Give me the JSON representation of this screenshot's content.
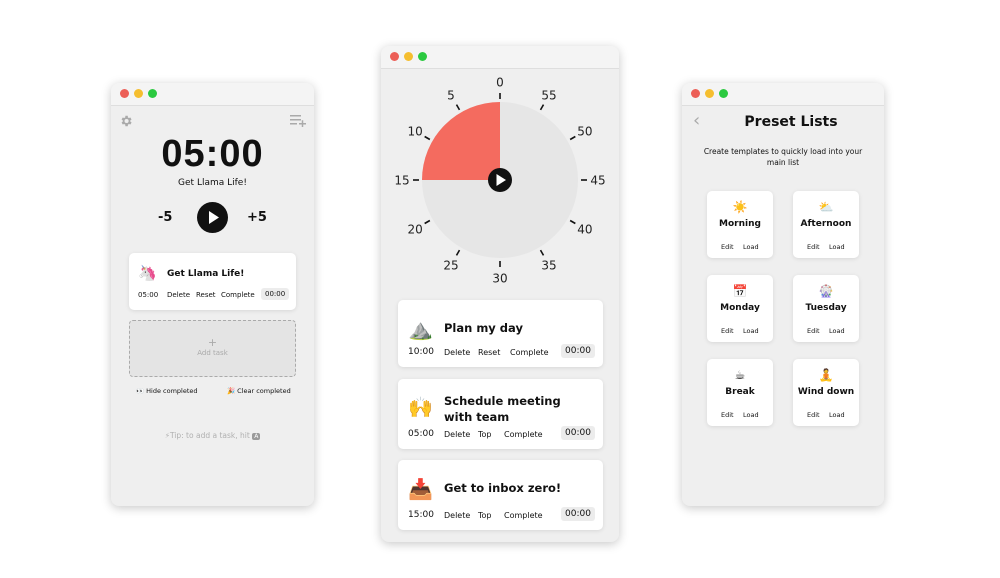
{
  "colors": {
    "red_dot": "#ec5f57",
    "yellow_dot": "#f5be2f",
    "green_dot": "#2bc940",
    "dial_sector": "#f46b5f",
    "dial_face": "#e6e6e6"
  },
  "left": {
    "settings_icon": "gear-icon",
    "list_icon": "playlist-add-icon",
    "timer": "05:00",
    "task_name": "Get Llama Life!",
    "minus": "-5",
    "plus": "+5",
    "card": {
      "emoji": "🦄",
      "title": "Get Llama Life!",
      "time": "05:00",
      "delete": "Delete",
      "reset": "Reset",
      "complete": "Complete",
      "elapsed": "00:00"
    },
    "add_plus": "+",
    "add_task": "Add task",
    "hide_completed": "👀 Hide completed",
    "clear_completed": "🎉 Clear completed",
    "tip": "⚡Tip: to add a task, hit",
    "tip_key": "A"
  },
  "center": {
    "dial": {
      "minutes": 15,
      "labels": [
        "0",
        "5",
        "10",
        "15",
        "20",
        "25",
        "30",
        "35",
        "40",
        "45",
        "50",
        "55"
      ]
    },
    "tasks": [
      {
        "emoji": "⛰️",
        "title_lines": [
          "Plan my day"
        ],
        "time": "10:00",
        "actions": [
          "Delete",
          "Reset",
          "Complete"
        ],
        "elapsed": "00:00"
      },
      {
        "emoji": "🙌",
        "title_lines": [
          "Schedule meeting",
          "with team"
        ],
        "time": "05:00",
        "actions": [
          "Delete",
          "Top",
          "Complete"
        ],
        "elapsed": "00:00"
      },
      {
        "emoji": "📥",
        "title_lines": [
          "Get to inbox zero!"
        ],
        "time": "15:00",
        "actions": [
          "Delete",
          "Top",
          "Complete"
        ],
        "elapsed": "00:00"
      }
    ]
  },
  "right": {
    "back": "‹",
    "title": "Preset Lists",
    "subtitle_lines": [
      "Create templates to quickly load into your",
      "main list"
    ],
    "presets": [
      {
        "emoji": "☀️",
        "name": "Morning",
        "edit": "Edit",
        "load": "Load"
      },
      {
        "emoji": "⛅",
        "name": "Afternoon",
        "edit": "Edit",
        "load": "Load"
      },
      {
        "emoji": "📅",
        "name": "Monday",
        "edit": "Edit",
        "load": "Load"
      },
      {
        "emoji": "🎡",
        "name": "Tuesday",
        "edit": "Edit",
        "load": "Load"
      },
      {
        "emoji": "☕",
        "name": "Break",
        "edit": "Edit",
        "load": "Load"
      },
      {
        "emoji": "🧘",
        "name": "Wind down",
        "edit": "Edit",
        "load": "Load"
      }
    ]
  }
}
